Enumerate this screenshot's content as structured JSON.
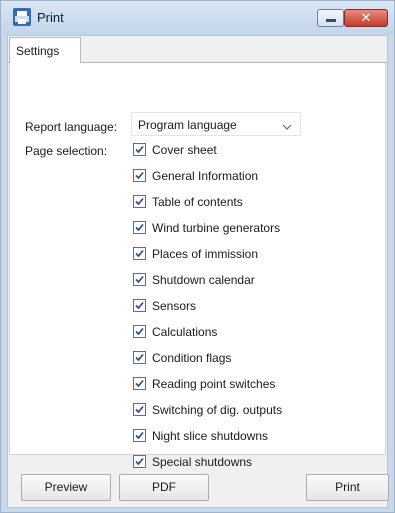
{
  "window": {
    "title": "Print",
    "icon": "app-print-icon",
    "controls": {
      "minimize_icon": "minimize-icon",
      "close_symbol": "✕"
    }
  },
  "tabs": [
    {
      "label": "Settings",
      "active": true
    }
  ],
  "settings": {
    "language_label": "Report language:",
    "language_value": "Program language",
    "page_selection_label": "Page selection:",
    "pages": [
      {
        "label": "Cover sheet",
        "checked": true
      },
      {
        "label": "General Information",
        "checked": true
      },
      {
        "label": "Table of contents",
        "checked": true
      },
      {
        "label": "Wind turbine generators",
        "checked": true
      },
      {
        "label": "Places of immission",
        "checked": true
      },
      {
        "label": "Shutdown calendar",
        "checked": true
      },
      {
        "label": "Sensors",
        "checked": true
      },
      {
        "label": "Calculations",
        "checked": true
      },
      {
        "label": "Condition flags",
        "checked": true
      },
      {
        "label": "Reading point switches",
        "checked": true
      },
      {
        "label": "Switching of dig. outputs",
        "checked": true
      },
      {
        "label": "Night slice shutdowns",
        "checked": true
      },
      {
        "label": "Special shutdowns",
        "checked": true
      }
    ]
  },
  "footer": {
    "preview_label": "Preview",
    "pdf_label": "PDF",
    "print_label": "Print"
  },
  "colors": {
    "titlebar": "#c9d9ec",
    "close_button": "#c43b2b",
    "checkmark": "#1f4f8a"
  }
}
